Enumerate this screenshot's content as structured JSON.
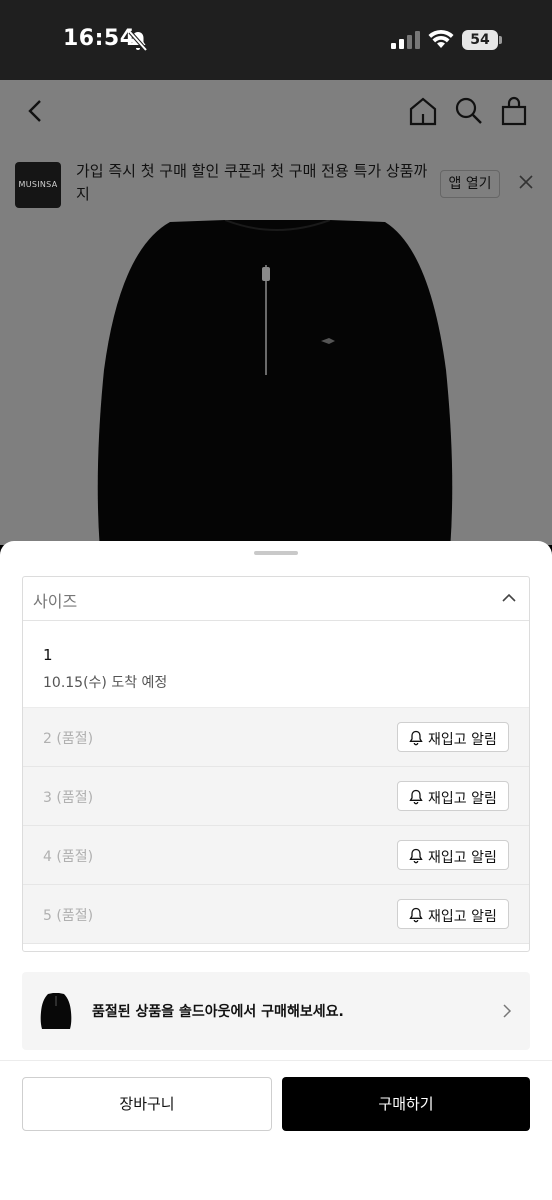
{
  "status_bar": {
    "time": "16:54",
    "battery": "54",
    "icons": [
      "bell-off-icon",
      "signal-icon",
      "wifi-icon",
      "battery-icon"
    ]
  },
  "nav": {
    "icons": [
      "back-chevron-icon",
      "home-icon",
      "search-icon",
      "shopping-bag-icon"
    ]
  },
  "app_banner": {
    "logo": "MUSINSA",
    "text": "가입 즉시 첫 구매 할인 쿠폰과 첫 구매 전용 특가 상품까지",
    "open_label": "앱 열기"
  },
  "size_selector": {
    "title": "사이즈",
    "options": [
      {
        "label": "1",
        "sub": "10.15(수) 도착 예정",
        "sold_out": false
      },
      {
        "label": "2 (품절)",
        "sold_out": true,
        "button": "재입고 알림"
      },
      {
        "label": "3 (품절)",
        "sold_out": true,
        "button": "재입고 알림"
      },
      {
        "label": "4 (품절)",
        "sold_out": true,
        "button": "재입고 알림"
      },
      {
        "label": "5 (품절)",
        "sold_out": true,
        "button": "재입고 알림"
      }
    ]
  },
  "soldout_banner": {
    "text": "품절된 상품을 솔드아웃에서 구매해보세요."
  },
  "actions": {
    "cart_label": "장바구니",
    "buy_label": "구매하기"
  },
  "colors": {
    "status_bar_bg": "#1f1f1f",
    "dim_overlay": "#7f7f7f",
    "primary_button": "#000000",
    "sold_out_row": "#f4f4f4"
  }
}
